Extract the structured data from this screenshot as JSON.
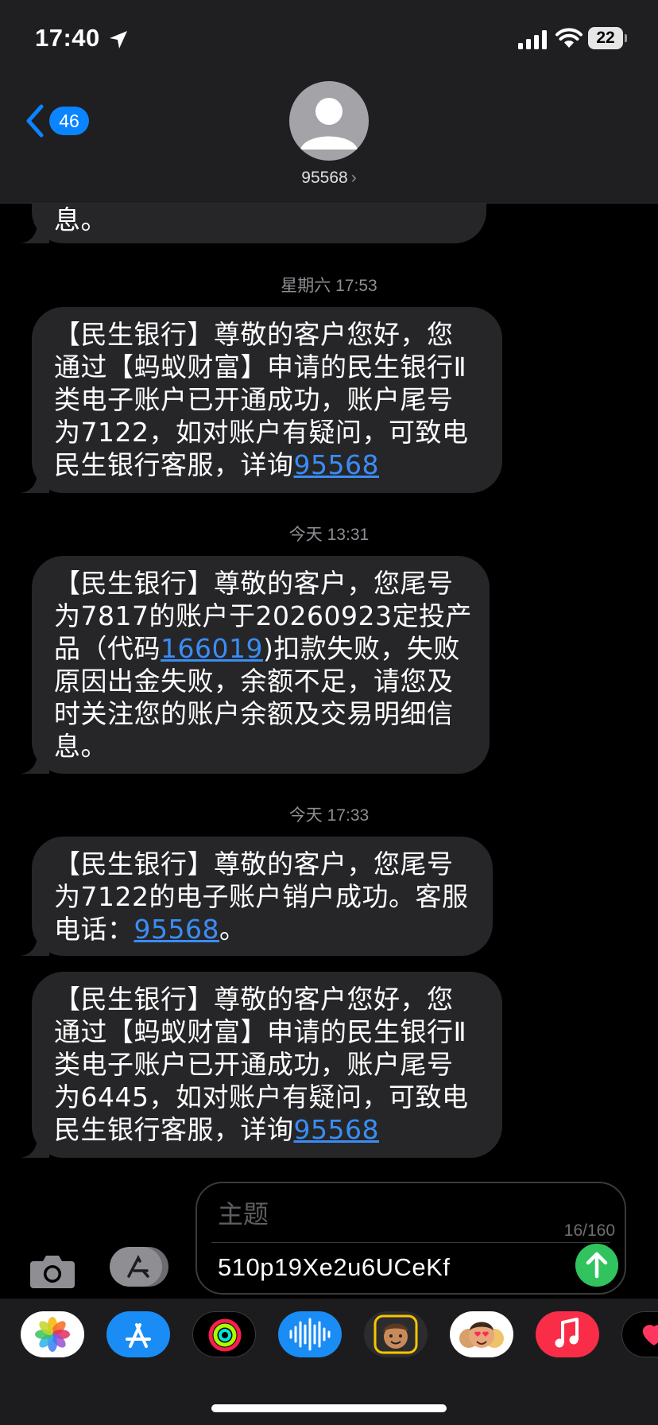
{
  "status_bar": {
    "time": "17:40",
    "battery": "22"
  },
  "header": {
    "unread_count": "46",
    "contact": "95568",
    "contact_chevron": "›"
  },
  "thread": {
    "partial_tail": "息。",
    "stamps": [
      "星期六 17:53",
      "今天 13:31",
      "今天 17:33"
    ],
    "messages": [
      {
        "lines": [
          "【民生银行】尊敬的客户您好，您",
          "通过【蚂蚁财富】申请的民生银行Ⅱ",
          "类电子账户已开通成功，账户尾号",
          "为7122，如对账户有疑问，可致电"
        ],
        "last_prefix": "民生银行客服，详询",
        "link": "95568"
      },
      {
        "line1": "【民生银行】尊敬的客户，您尾号",
        "line2": "为7817的账户于20260923定投产",
        "line3_prefix": "品（代码",
        "link": "166019",
        "line3_suffix": ")扣款失败，失败",
        "line4": "原因出金失败，余额不足，请您及",
        "line5": "时关注您的账户余额及交易明细信",
        "line6": "息。"
      },
      {
        "line1": "【民生银行】尊敬的客户，您尾号",
        "line2": "为7122的电子账户销户成功。客服",
        "line3_prefix": "电话：",
        "link": "95568",
        "line3_suffix": "。"
      },
      {
        "lines": [
          "【民生银行】尊敬的客户您好，您",
          "通过【蚂蚁财富】申请的民生银行Ⅱ",
          "类电子账户已开通成功，账户尾号",
          "为6445，如对账户有疑问，可致电"
        ],
        "last_prefix": "民生银行客服，详询",
        "link": "95568"
      }
    ]
  },
  "composer": {
    "subject_placeholder": "主题",
    "counter": "16/160",
    "body": "510p19Xe2u6UCeKf"
  },
  "app_drawer": {
    "apps": [
      "photos",
      "app-store",
      "activity",
      "audio-message",
      "memoji-stickers",
      "memoji",
      "music",
      "digital-touch"
    ]
  },
  "colors": {
    "accent": "#0a84ff",
    "send": "#30c35e",
    "bubble": "#262628",
    "link": "#3a8df5"
  }
}
